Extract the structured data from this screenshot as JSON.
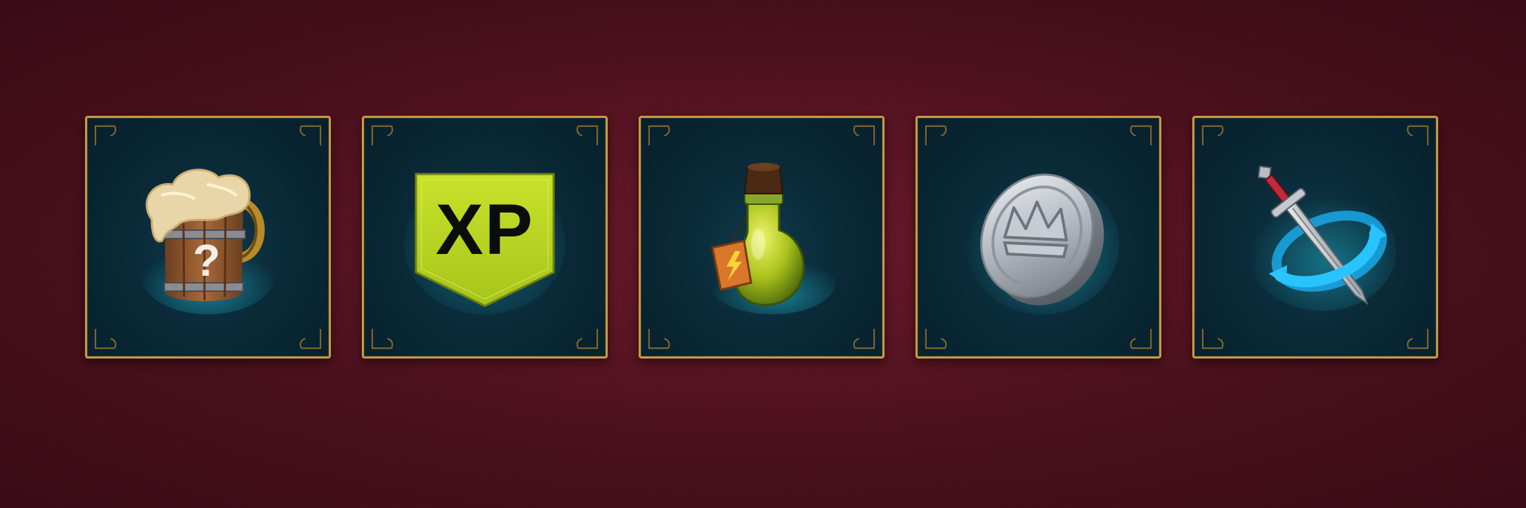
{
  "background_color": "#4f1120",
  "tile_border_color": "#c79a3e",
  "tile_fill_color": "#0a2a38",
  "rewards": [
    {
      "id": "mystery-mug",
      "icon": "mystery-ale-mug-icon"
    },
    {
      "id": "xp",
      "icon": "xp-banner-icon",
      "label": "XP"
    },
    {
      "id": "energy-potion",
      "icon": "energy-potion-icon"
    },
    {
      "id": "crown-coin",
      "icon": "silver-crown-coin-icon"
    },
    {
      "id": "sword-refresh",
      "icon": "sword-refresh-icon"
    }
  ]
}
